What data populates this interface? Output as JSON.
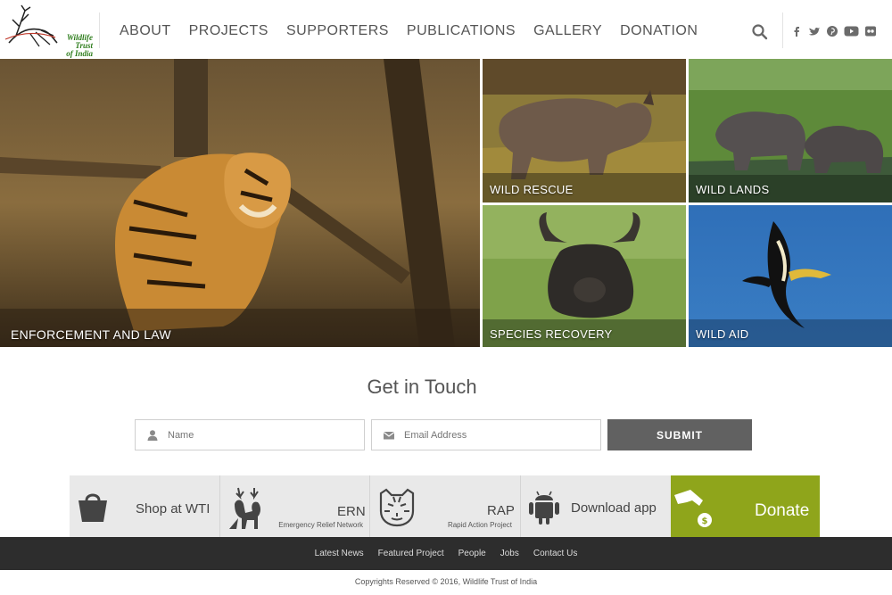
{
  "brand": {
    "logo_text_line1": "Wildlife",
    "logo_text_line2": "Trust",
    "logo_text_line3": "of India",
    "logo_color": "#2e7d1c"
  },
  "nav": {
    "items": [
      {
        "label": "ABOUT"
      },
      {
        "label": "PROJECTS"
      },
      {
        "label": "SUPPORTERS"
      },
      {
        "label": "PUBLICATIONS"
      },
      {
        "label": "GALLERY"
      },
      {
        "label": "DONATION"
      }
    ]
  },
  "header_icons": {
    "search": "search-icon",
    "social": [
      "facebook-icon",
      "twitter-icon",
      "pinterest-icon",
      "youtube-icon",
      "flickr-icon"
    ]
  },
  "tiles": {
    "enforcement": "ENFORCEMENT AND LAW",
    "wild_rescue": "WILD RESCUE",
    "wild_lands": "WILD LANDS",
    "species_recovery": "SPECIES RECOVERY",
    "wild_aid": "WILD AID"
  },
  "contact": {
    "title": "Get in Touch",
    "name_placeholder": "Name",
    "email_placeholder": "Email Address",
    "submit_label": "SUBMIT"
  },
  "actions": {
    "shop_label": "Shop at WTI",
    "ern_label": "ERN",
    "ern_sub": "Emergency Relief Network",
    "rap_label": "RAP",
    "rap_sub": "Rapid Action Project",
    "app_label": "Download app",
    "donate_label": "Donate",
    "donate_color": "#8fa51b"
  },
  "footer": {
    "links": [
      {
        "label": "Latest News"
      },
      {
        "label": "Featured Project"
      },
      {
        "label": "People"
      },
      {
        "label": "Jobs"
      },
      {
        "label": "Contact Us"
      }
    ],
    "copyright": "Copyrights Reserved © 2016, Wildlife Trust of India"
  }
}
